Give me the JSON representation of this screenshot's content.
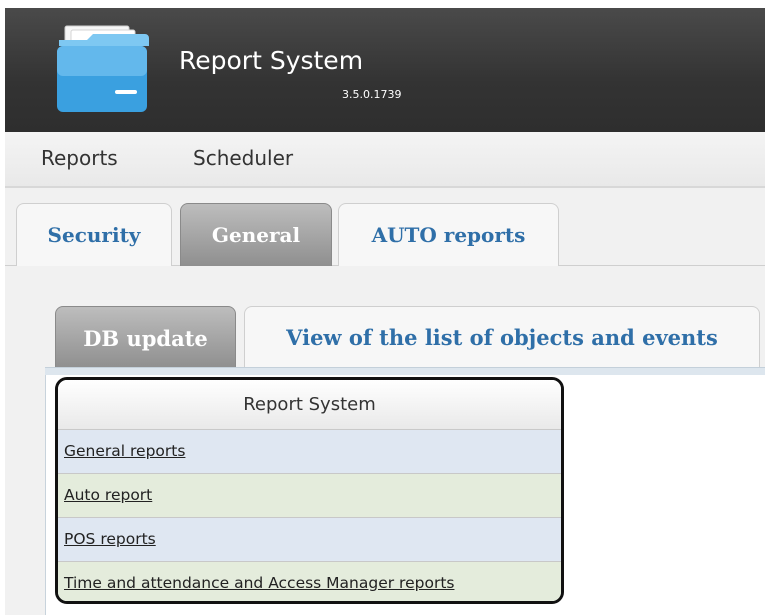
{
  "header": {
    "title": "Report System",
    "version": "3.5.0.1739",
    "logo_icon": "folder-icon"
  },
  "menu": {
    "items": [
      "Reports",
      "Scheduler"
    ]
  },
  "outer_tabs": {
    "items": [
      "Security",
      "General",
      "AUTO reports"
    ],
    "active": "General"
  },
  "inner_tabs": {
    "items": [
      "DB update",
      "View of the list of objects and events"
    ],
    "active": "DB update"
  },
  "report_panel": {
    "title": "Report System",
    "items": [
      "General reports",
      "Auto report",
      "POS reports",
      "Time and attendance and Access Manager reports"
    ]
  },
  "colors": {
    "header_bg": "#333333",
    "link_blue": "#2f6fa8",
    "row_blue": "#dfe7f2",
    "row_green": "#e4ecdc"
  }
}
